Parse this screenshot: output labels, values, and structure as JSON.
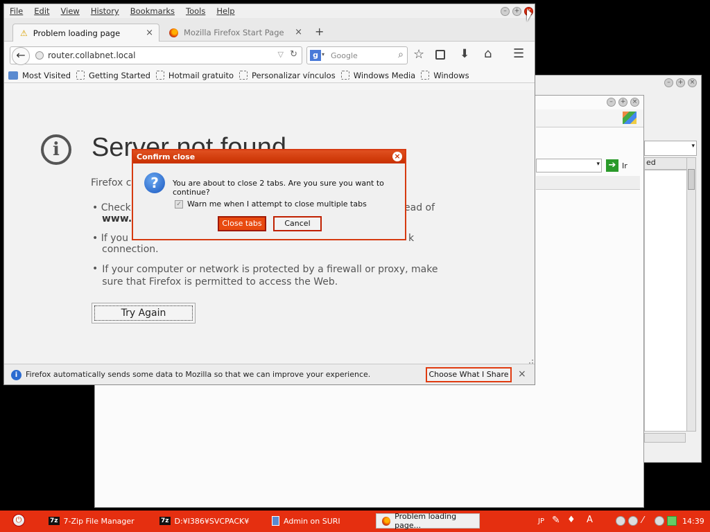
{
  "firefox": {
    "menu": [
      "File",
      "Edit",
      "View",
      "History",
      "Bookmarks",
      "Tools",
      "Help"
    ],
    "tabs": [
      {
        "title": "Problem loading page"
      },
      {
        "title": "Mozilla Firefox Start Page"
      }
    ],
    "url": "router.collabnet.local",
    "search_placeholder": "Google",
    "bookmarks": [
      "Most Visited",
      "Getting Started",
      "Hotmail gratuito",
      "Personalizar vínculos",
      "Windows Media",
      "Windows"
    ],
    "error": {
      "title": "Server not found",
      "intro": "Firefox ca",
      "bullet1_start": "Check",
      "bullet1_end": "ead of",
      "bullet1_line2": "www.",
      "bullet2_start": "If you",
      "bullet2_end": "k",
      "bullet2_line2": "connection.",
      "bullet3": "If your computer or network is protected by a firewall or proxy, make sure that Firefox is permitted to access the Web.",
      "try_again": "Try Again"
    },
    "notification": {
      "text": "Firefox automatically sends some data to Mozilla so that we can improve your experience.",
      "button": "Choose What I Share"
    }
  },
  "dialog": {
    "title": "Confirm close",
    "message": "You are about to close 2 tabs. Are you sure you want to continue?",
    "checkbox_label": "Warn me when I attempt to close multiple tabs",
    "checkbox_checked": true,
    "confirm": "Close tabs",
    "cancel": "Cancel"
  },
  "background_window": {
    "address_fragment": "Ir",
    "column_fragment": "ed"
  },
  "taskbar": {
    "tasks": [
      {
        "label": "7-Zip File Manager",
        "icon": "7z"
      },
      {
        "label": "D:¥I386¥SVCPACK¥",
        "icon": "7z"
      },
      {
        "label": "Admin on SURI"
      },
      {
        "label": "Problem loading page..."
      }
    ],
    "lang": "JP",
    "time": "14:39"
  },
  "colors": {
    "accent": "#e52f10",
    "dialog_border": "#d63a10"
  }
}
